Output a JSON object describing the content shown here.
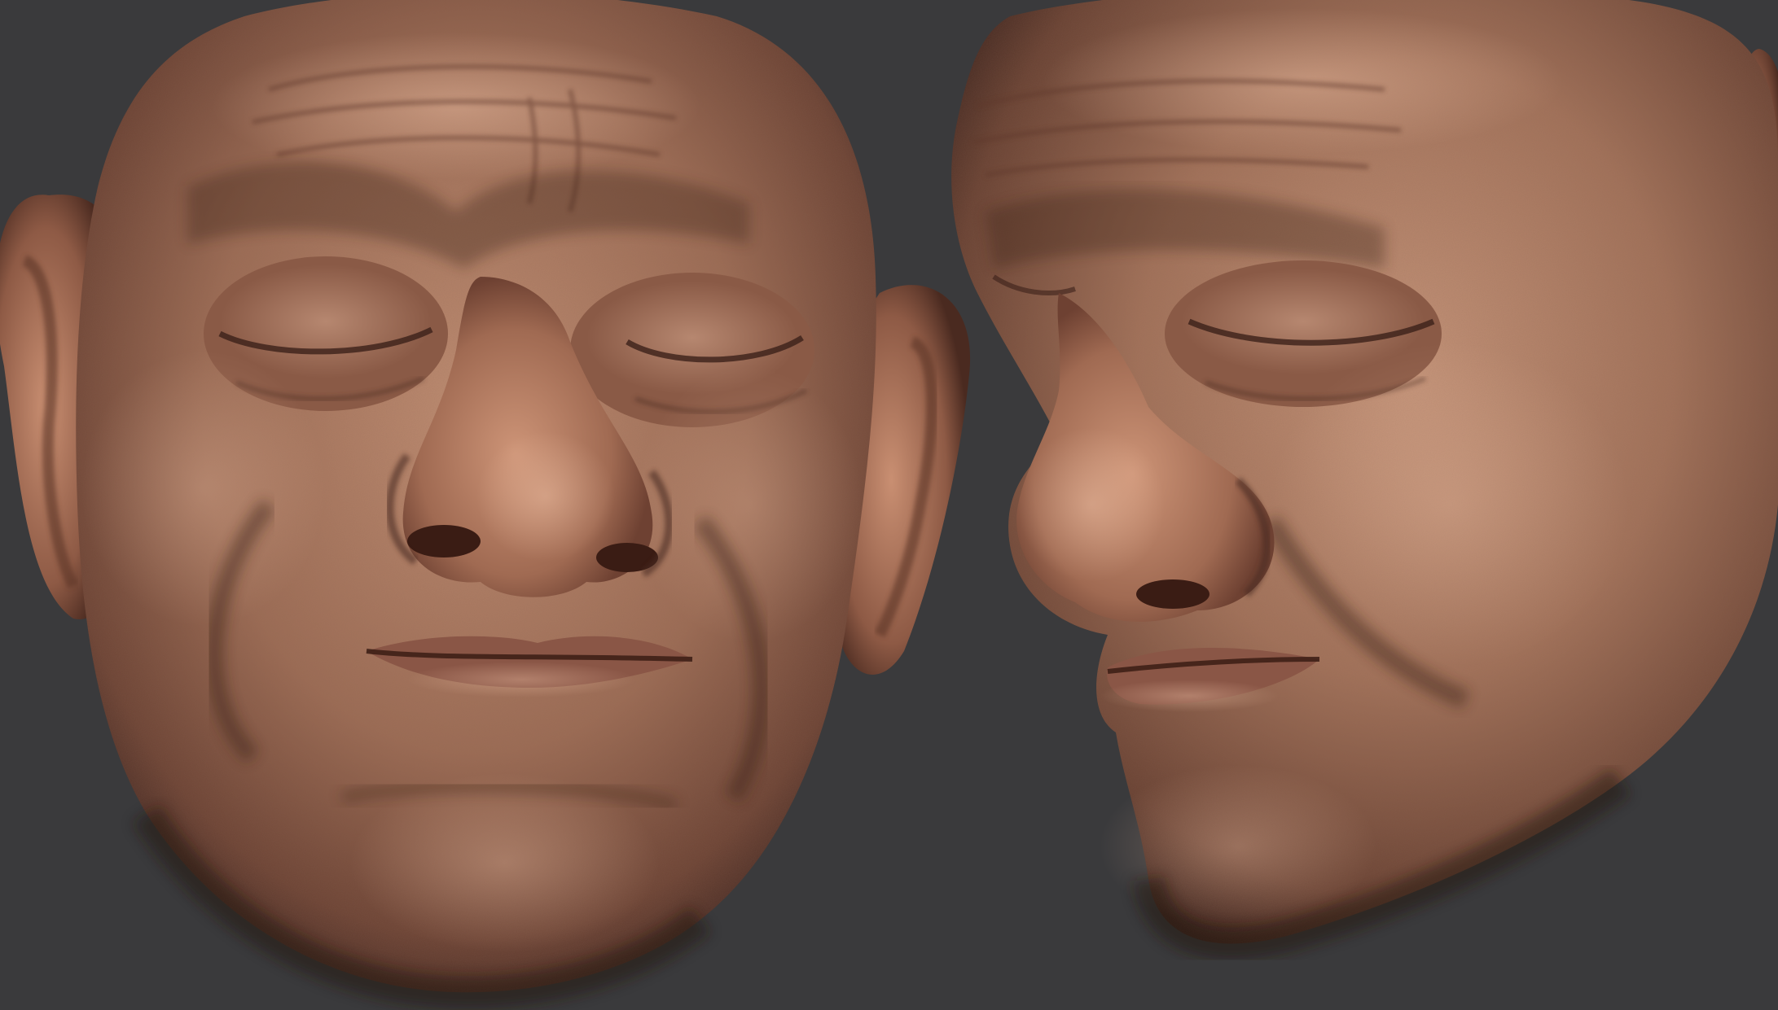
{
  "scene": {
    "background_color": "#3a3a3c",
    "skin_base_color": "#a0705a",
    "skin_highlight_color": "#d6a48a",
    "skin_shadow_color": "#4a2a20",
    "views": [
      {
        "view": "front"
      },
      {
        "view": "three-quarter"
      }
    ]
  }
}
